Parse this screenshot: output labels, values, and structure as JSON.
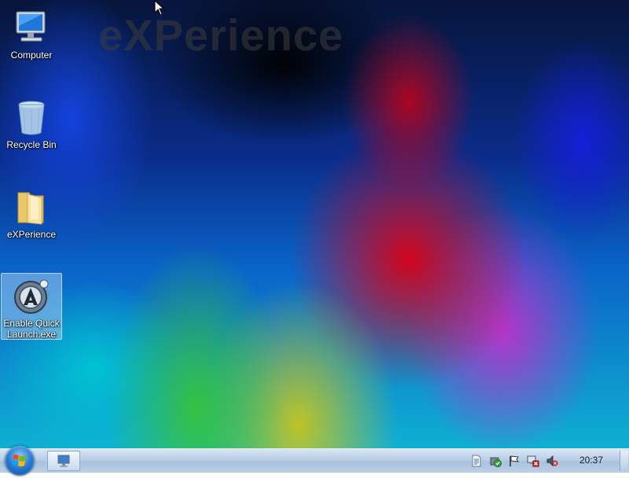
{
  "desktop": {
    "watermark": "eXPerience",
    "icons": [
      {
        "label": "Computer",
        "icon": "computer-icon"
      },
      {
        "label": "Recycle Bin",
        "icon": "recycle-bin-icon"
      },
      {
        "label": "eXPerience",
        "icon": "folder-icon"
      },
      {
        "label": "Enable Quick Launch.exe",
        "icon": "app-shortcut-icon",
        "selected": true
      }
    ]
  },
  "taskbar": {
    "start_icon": "windows-logo-icon",
    "pinned": [
      {
        "icon": "remote-desktop-icon"
      }
    ],
    "tray": [
      {
        "icon": "document-icon"
      },
      {
        "icon": "security-shield-icon"
      },
      {
        "icon": "action-center-flag-icon"
      },
      {
        "icon": "network-disconnected-icon"
      },
      {
        "icon": "volume-muted-icon"
      }
    ],
    "clock": "20:37"
  },
  "colors": {
    "taskbar": "#bcd0e6",
    "selection": "#a0c8f0"
  }
}
